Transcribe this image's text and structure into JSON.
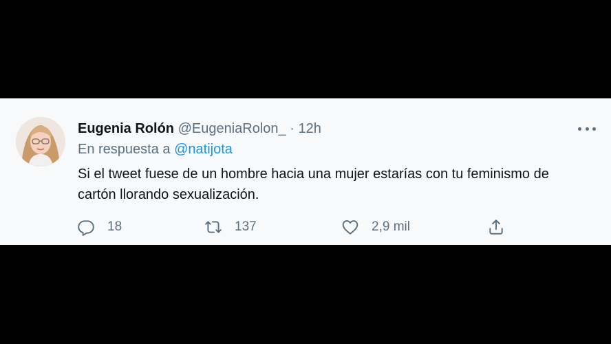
{
  "tweet": {
    "display_name": "Eugenia Rolón",
    "handle": "@EugeniaRolon_",
    "separator": "·",
    "time": "12h",
    "reply_prefix": "En respuesta a",
    "reply_to": "@natijota",
    "text": "Si el tweet fuese de un hombre hacia una mujer estarías con tu feminismo de cartón llorando sexualización.",
    "more_icon": "more-horizontal-icon"
  },
  "actions": {
    "reply": {
      "icon": "reply-icon",
      "count": "18"
    },
    "retweet": {
      "icon": "retweet-icon",
      "count": "137"
    },
    "like": {
      "icon": "heart-icon",
      "count": "2,9 mil"
    },
    "share": {
      "icon": "share-icon"
    }
  },
  "colors": {
    "background": "#000000",
    "card": "#f7f9fa",
    "primary_text": "#0f1419",
    "secondary_text": "#5b7083",
    "link": "#1b95e0"
  }
}
